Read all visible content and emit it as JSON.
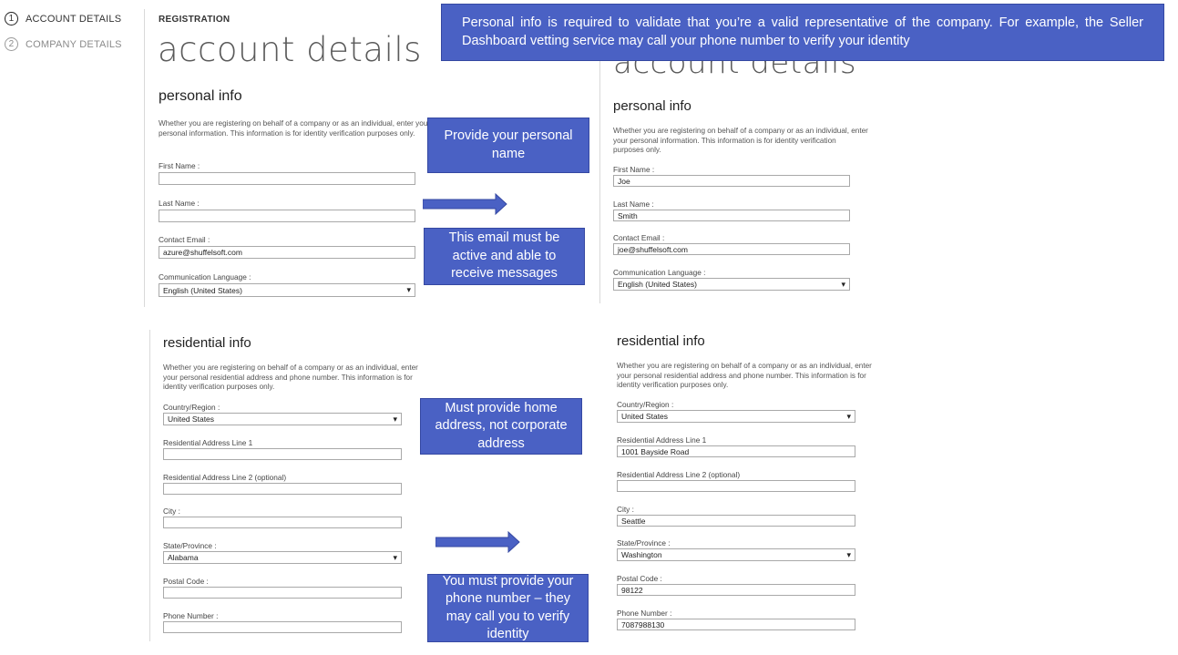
{
  "steps": [
    {
      "num": "1",
      "label": "ACCOUNT DETAILS"
    },
    {
      "num": "2",
      "label": "COMPANY DETAILS"
    }
  ],
  "left": {
    "registration": "REGISTRATION",
    "title": "account details",
    "personal": {
      "heading": "personal info",
      "desc": "Whether you are registering on behalf of a company or as an individual, enter your personal information. This information is for identity verification purposes only.",
      "first_name_label": "First Name :",
      "first_name_value": "",
      "last_name_label": "Last Name :",
      "last_name_value": "",
      "email_label": "Contact Email :",
      "email_value": "azure@shuffelsoft.com",
      "lang_label": "Communication Language :",
      "lang_value": "English (United States)"
    },
    "residential": {
      "heading": "residential info",
      "desc": "Whether you are registering on behalf of a company or as an individual, enter your personal residential address and phone number. This information is for identity verification purposes only.",
      "country_label": "Country/Region :",
      "country_value": "United States",
      "addr1_label": "Residential Address Line 1",
      "addr1_value": "",
      "addr2_label": "Residential Address Line 2 (optional)",
      "addr2_value": "",
      "city_label": "City :",
      "city_value": "",
      "state_label": "State/Province :",
      "state_value": "Alabama",
      "postal_label": "Postal Code :",
      "postal_value": "",
      "phone_label": "Phone Number :",
      "phone_value": ""
    }
  },
  "right": {
    "title": "account details",
    "personal": {
      "heading": "personal info",
      "desc": "Whether you are registering on behalf of a company or as an individual, enter your personal information. This information is for identity verification purposes only.",
      "first_name_label": "First Name :",
      "first_name_value": "Joe",
      "last_name_label": "Last Name :",
      "last_name_value": "Smith",
      "email_label": "Contact Email :",
      "email_value": "joe@shuffelsoft.com",
      "lang_label": "Communication Language :",
      "lang_value": "English (United States)"
    },
    "residential": {
      "heading": "residential info",
      "desc": "Whether you are registering on behalf of a company or as an individual, enter your personal residential address and phone number. This information is for identity verification purposes only.",
      "country_label": "Country/Region :",
      "country_value": "United States",
      "addr1_label": "Residential Address Line 1",
      "addr1_value": "1001 Bayside Road",
      "addr2_label": "Residential Address Line 2 (optional)",
      "addr2_value": "",
      "city_label": "City :",
      "city_value": "Seattle",
      "state_label": "State/Province :",
      "state_value": "Washington",
      "postal_label": "Postal Code :",
      "postal_value": "98122",
      "phone_label": "Phone Number :",
      "phone_value": "7087988130"
    }
  },
  "callouts": {
    "top": "Personal info is required to validate that you’re a valid representative of the company. For example, the Seller Dashboard vetting service may call your phone number to verify your identity",
    "name": "Provide your personal name",
    "email": "This email must be active and able to receive messages",
    "home": "Must provide home address, not corporate address",
    "phone": "You must provide your phone number – they may call you to verify identity"
  },
  "colors": {
    "callout": "#4a61c4",
    "arrow": "#4a61c4"
  }
}
